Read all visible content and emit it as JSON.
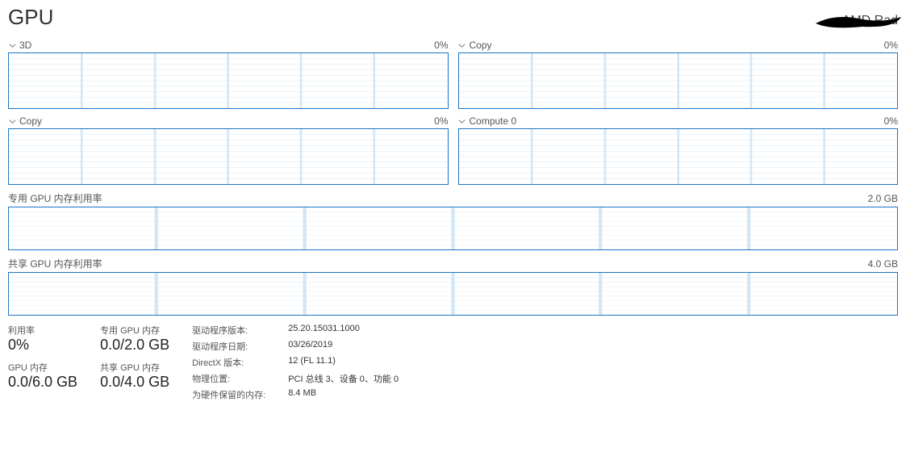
{
  "header": {
    "title": "GPU",
    "device": "AMD Rad"
  },
  "panels": {
    "p0": {
      "label": "3D",
      "value": "0%"
    },
    "p1": {
      "label": "Copy",
      "value": "0%"
    },
    "p2": {
      "label": "Copy",
      "value": "0%"
    },
    "p3": {
      "label": "Compute 0",
      "value": "0%"
    }
  },
  "mem_panels": {
    "dedicated": {
      "label": "专用 GPU 内存利用率",
      "value": "2.0 GB"
    },
    "shared": {
      "label": "共享 GPU 内存利用率",
      "value": "4.0 GB"
    }
  },
  "stats": {
    "utilization": {
      "label": "利用率",
      "value": "0%"
    },
    "gpu_mem": {
      "label": "GPU 内存",
      "value": "0.0/6.0 GB"
    },
    "dedicated": {
      "label": "专用 GPU 内存",
      "value": "0.0/2.0 GB"
    },
    "shared": {
      "label": "共享 GPU 内存",
      "value": "0.0/4.0 GB"
    }
  },
  "details": {
    "driver_version_k": "驱动程序版本:",
    "driver_version_v": "25.20.15031.1000",
    "driver_date_k": "驱动程序日期:",
    "driver_date_v": "03/26/2019",
    "directx_k": "DirectX 版本:",
    "directx_v": "12 (FL 11.1)",
    "location_k": "物理位置:",
    "location_v": "PCI 总线 3、设备 0、功能 0",
    "reserved_k": "为硬件保留的内存:",
    "reserved_v": "8.4 MB"
  },
  "chart_data": [
    {
      "type": "area",
      "title": "3D",
      "x": [
        0,
        60
      ],
      "values_pct": [
        0,
        0
      ],
      "ylim": [
        0,
        100
      ]
    },
    {
      "type": "area",
      "title": "Copy",
      "x": [
        0,
        60
      ],
      "values_pct": [
        0,
        0
      ],
      "ylim": [
        0,
        100
      ]
    },
    {
      "type": "area",
      "title": "Copy",
      "x": [
        0,
        60
      ],
      "values_pct": [
        0,
        0
      ],
      "ylim": [
        0,
        100
      ]
    },
    {
      "type": "area",
      "title": "Compute 0",
      "x": [
        0,
        60
      ],
      "values_pct": [
        0,
        0
      ],
      "ylim": [
        0,
        100
      ]
    },
    {
      "type": "area",
      "title": "专用 GPU 内存利用率",
      "x": [
        0,
        60
      ],
      "values_gb": [
        0,
        0
      ],
      "ylim": [
        0,
        2.0
      ],
      "yunit": "GB"
    },
    {
      "type": "area",
      "title": "共享 GPU 内存利用率",
      "x": [
        0,
        60
      ],
      "values_gb": [
        0,
        0
      ],
      "ylim": [
        0,
        4.0
      ],
      "yunit": "GB"
    }
  ]
}
